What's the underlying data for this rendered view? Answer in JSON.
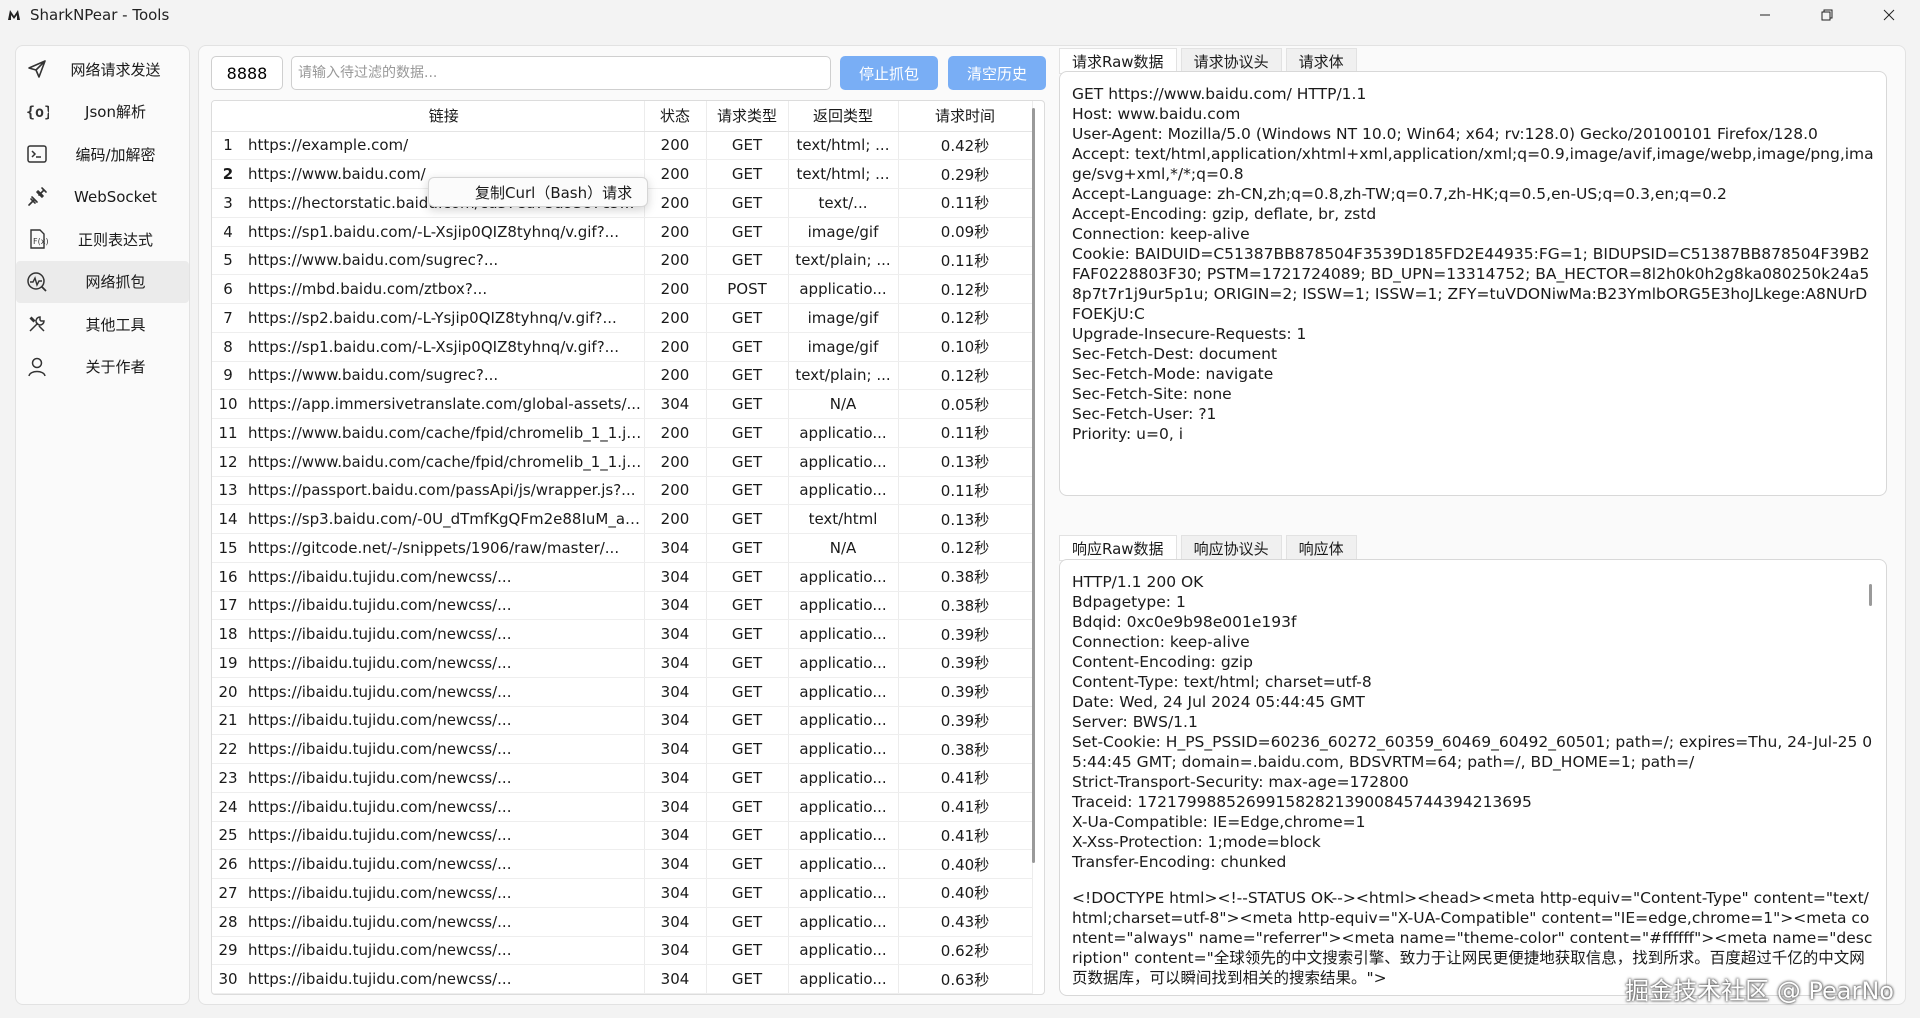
{
  "window": {
    "title": "SharkNPear - Tools",
    "controls": [
      "minimize-icon",
      "restore-icon",
      "close-icon"
    ]
  },
  "sidebar": {
    "items": [
      {
        "label": "网络请求发送",
        "icon": "send-icon"
      },
      {
        "label": "Json解析",
        "icon": "json-braces-icon"
      },
      {
        "label": "编码/加解密",
        "icon": "terminal-icon"
      },
      {
        "label": "WebSocket",
        "icon": "websocket-icon"
      },
      {
        "label": "正则表达式",
        "icon": "regex-icon"
      },
      {
        "label": "网络抓包",
        "icon": "capture-icon",
        "active": true
      },
      {
        "label": "其他工具",
        "icon": "tools-icon"
      },
      {
        "label": "关于作者",
        "icon": "person-icon"
      }
    ]
  },
  "toolbar": {
    "port": "8888",
    "filter_placeholder": "请输入待过滤的数据...",
    "stop_label": "停止抓包",
    "clear_label": "清空历史"
  },
  "table": {
    "headers": [
      "链接",
      "状态",
      "请求类型",
      "返回类型",
      "请求时间"
    ],
    "rows": [
      {
        "n": "1",
        "url": "https://example.com/",
        "status": "200",
        "method": "GET",
        "type": "text/html; ...",
        "time": "0.42秒"
      },
      {
        "n": "2",
        "url": "https://www.baidu.com/",
        "status": "200",
        "method": "GET",
        "type": "text/html; ...",
        "time": "0.29秒"
      },
      {
        "n": "3",
        "url": "https://hectorstatic.baidu.com/cd37ed75a9387c5b.js",
        "status": "200",
        "method": "GET",
        "type": "text/...",
        "time": "0.11秒"
      },
      {
        "n": "4",
        "url": "https://sp1.baidu.com/-L-Xsjip0QIZ8tyhnq/v.gif?...",
        "status": "200",
        "method": "GET",
        "type": "image/gif",
        "time": "0.09秒"
      },
      {
        "n": "5",
        "url": "https://www.baidu.com/sugrec?...",
        "status": "200",
        "method": "GET",
        "type": "text/plain; ...",
        "time": "0.11秒"
      },
      {
        "n": "6",
        "url": "https://mbd.baidu.com/ztbox?...",
        "status": "200",
        "method": "POST",
        "type": "applicatio...",
        "time": "0.12秒"
      },
      {
        "n": "7",
        "url": "https://sp2.baidu.com/-L-Ysjip0QIZ8tyhnq/v.gif?...",
        "status": "200",
        "method": "GET",
        "type": "image/gif",
        "time": "0.12秒"
      },
      {
        "n": "8",
        "url": "https://sp1.baidu.com/-L-Xsjip0QIZ8tyhnq/v.gif?...",
        "status": "200",
        "method": "GET",
        "type": "image/gif",
        "time": "0.10秒"
      },
      {
        "n": "9",
        "url": "https://www.baidu.com/sugrec?...",
        "status": "200",
        "method": "GET",
        "type": "text/plain; ...",
        "time": "0.12秒"
      },
      {
        "n": "10",
        "url": "https://app.immersivetranslate.com/global-assets/...",
        "status": "304",
        "method": "GET",
        "type": "N/A",
        "time": "0.05秒"
      },
      {
        "n": "11",
        "url": "https://www.baidu.com/cache/fpid/chromelib_1_1.js?...",
        "status": "200",
        "method": "GET",
        "type": "applicatio...",
        "time": "0.11秒"
      },
      {
        "n": "12",
        "url": "https://www.baidu.com/cache/fpid/chromelib_1_1.js?...",
        "status": "200",
        "method": "GET",
        "type": "applicatio...",
        "time": "0.13秒"
      },
      {
        "n": "13",
        "url": "https://passport.baidu.com/passApi/js/wrapper.js?...",
        "status": "200",
        "method": "GET",
        "type": "applicatio...",
        "time": "0.11秒"
      },
      {
        "n": "14",
        "url": "https://sp3.baidu.com/-0U_dTmfKgQFm2e88IuM_a/...",
        "status": "200",
        "method": "GET",
        "type": "text/html",
        "time": "0.13秒"
      },
      {
        "n": "15",
        "url": "https://gitcode.net/-/snippets/1906/raw/master/...",
        "status": "304",
        "method": "GET",
        "type": "N/A",
        "time": "0.12秒"
      },
      {
        "n": "16",
        "url": "https://ibaidu.tujidu.com/newcss/...",
        "status": "304",
        "method": "GET",
        "type": "applicatio...",
        "time": "0.38秒"
      },
      {
        "n": "17",
        "url": "https://ibaidu.tujidu.com/newcss/...",
        "status": "304",
        "method": "GET",
        "type": "applicatio...",
        "time": "0.38秒"
      },
      {
        "n": "18",
        "url": "https://ibaidu.tujidu.com/newcss/...",
        "status": "304",
        "method": "GET",
        "type": "applicatio...",
        "time": "0.39秒"
      },
      {
        "n": "19",
        "url": "https://ibaidu.tujidu.com/newcss/...",
        "status": "304",
        "method": "GET",
        "type": "applicatio...",
        "time": "0.39秒"
      },
      {
        "n": "20",
        "url": "https://ibaidu.tujidu.com/newcss/...",
        "status": "304",
        "method": "GET",
        "type": "applicatio...",
        "time": "0.39秒"
      },
      {
        "n": "21",
        "url": "https://ibaidu.tujidu.com/newcss/...",
        "status": "304",
        "method": "GET",
        "type": "applicatio...",
        "time": "0.39秒"
      },
      {
        "n": "22",
        "url": "https://ibaidu.tujidu.com/newcss/...",
        "status": "304",
        "method": "GET",
        "type": "applicatio...",
        "time": "0.38秒"
      },
      {
        "n": "23",
        "url": "https://ibaidu.tujidu.com/newcss/...",
        "status": "304",
        "method": "GET",
        "type": "applicatio...",
        "time": "0.41秒"
      },
      {
        "n": "24",
        "url": "https://ibaidu.tujidu.com/newcss/...",
        "status": "304",
        "method": "GET",
        "type": "applicatio...",
        "time": "0.41秒"
      },
      {
        "n": "25",
        "url": "https://ibaidu.tujidu.com/newcss/...",
        "status": "304",
        "method": "GET",
        "type": "applicatio...",
        "time": "0.41秒"
      },
      {
        "n": "26",
        "url": "https://ibaidu.tujidu.com/newcss/...",
        "status": "304",
        "method": "GET",
        "type": "applicatio...",
        "time": "0.40秒"
      },
      {
        "n": "27",
        "url": "https://ibaidu.tujidu.com/newcss/...",
        "status": "304",
        "method": "GET",
        "type": "applicatio...",
        "time": "0.40秒"
      },
      {
        "n": "28",
        "url": "https://ibaidu.tujidu.com/newcss/...",
        "status": "304",
        "method": "GET",
        "type": "applicatio...",
        "time": "0.43秒"
      },
      {
        "n": "29",
        "url": "https://ibaidu.tujidu.com/newcss/...",
        "status": "304",
        "method": "GET",
        "type": "applicatio...",
        "time": "0.62秒"
      },
      {
        "n": "30",
        "url": "https://ibaidu.tujidu.com/newcss/...",
        "status": "304",
        "method": "GET",
        "type": "applicatio...",
        "time": "0.63秒"
      }
    ],
    "selected_row": "2"
  },
  "context_menu": {
    "item": "复制Curl（Bash）请求"
  },
  "request": {
    "tabs": [
      "请求Raw数据",
      "请求协议头",
      "请求体"
    ],
    "lines": [
      "GET https://www.baidu.com/ HTTP/1.1",
      "Host: www.baidu.com",
      "User-Agent: Mozilla/5.0 (Windows NT 10.0; Win64; x64; rv:128.0) Gecko/20100101 Firefox/128.0",
      "Accept: text/html,application/xhtml+xml,application/xml;q=0.9,image/avif,image/webp,image/png,image/svg+xml,*/*;q=0.8",
      "Accept-Language: zh-CN,zh;q=0.8,zh-TW;q=0.7,zh-HK;q=0.5,en-US;q=0.3,en;q=0.2",
      "Accept-Encoding: gzip, deflate, br, zstd",
      "Connection: keep-alive",
      "Cookie: BAIDUID=C51387BB878504F3539D185FD2E44935:FG=1; BIDUPSID=C51387BB878504F39B2FAF0228803F30; PSTM=1721724089; BD_UPN=13314752; BA_HECTOR=8l2h0k0h2g8ka080250k24a58p7t7r1j9ur5p1u; ORIGIN=2; ISSW=1; ISSW=1; ZFY=tuVDONiwMa:B23YmlbORG5E3hoJLkege:A8NUrDFOEKjU:C",
      "Upgrade-Insecure-Requests: 1",
      "Sec-Fetch-Dest: document",
      "Sec-Fetch-Mode: navigate",
      "Sec-Fetch-Site: none",
      "Sec-Fetch-User: ?1",
      "Priority: u=0, i"
    ]
  },
  "response": {
    "tabs": [
      "响应Raw数据",
      "响应协议头",
      "响应体"
    ],
    "lines": [
      "HTTP/1.1 200 OK",
      "Bdpagetype: 1",
      "Bdqid: 0xc0e9b98e001e193f",
      "Connection: keep-alive",
      "Content-Encoding: gzip",
      "Content-Type: text/html; charset=utf-8",
      "Date: Wed, 24 Jul 2024 05:44:45 GMT",
      "Server: BWS/1.1",
      "Set-Cookie: H_PS_PSSID=60236_60272_60359_60469_60492_60501; path=/; expires=Thu, 24-Jul-25 05:44:45 GMT; domain=.baidu.com, BDSVRTM=64; path=/, BD_HOME=1; path=/",
      "Strict-Transport-Security: max-age=172800",
      "Traceid: 1721799885269915828213900845744394213695",
      "X-Ua-Compatible: IE=Edge,chrome=1",
      "X-Xss-Protection: 1;mode=block",
      "Transfer-Encoding: chunked",
      "",
      "<!DOCTYPE html><!--STATUS OK--><html><head><meta http-equiv=\"Content-Type\" content=\"text/html;charset=utf-8\"><meta http-equiv=\"X-UA-Compatible\" content=\"IE=edge,chrome=1\"><meta content=\"always\" name=\"referrer\"><meta name=\"theme-color\" content=\"#ffffff\"><meta name=\"description\" content=\"全球领先的中文搜索引擎、致力于让网民更便捷地获取信息，找到所求。百度超过千亿的中文网页数据库，可以瞬间找到相关的搜索结果。\">"
    ]
  },
  "watermark": "掘金技术社区 @ PearNo",
  "colors": {
    "accent_button": "#79aef5",
    "background": "#f3f3f3",
    "panel": "#ffffff"
  }
}
